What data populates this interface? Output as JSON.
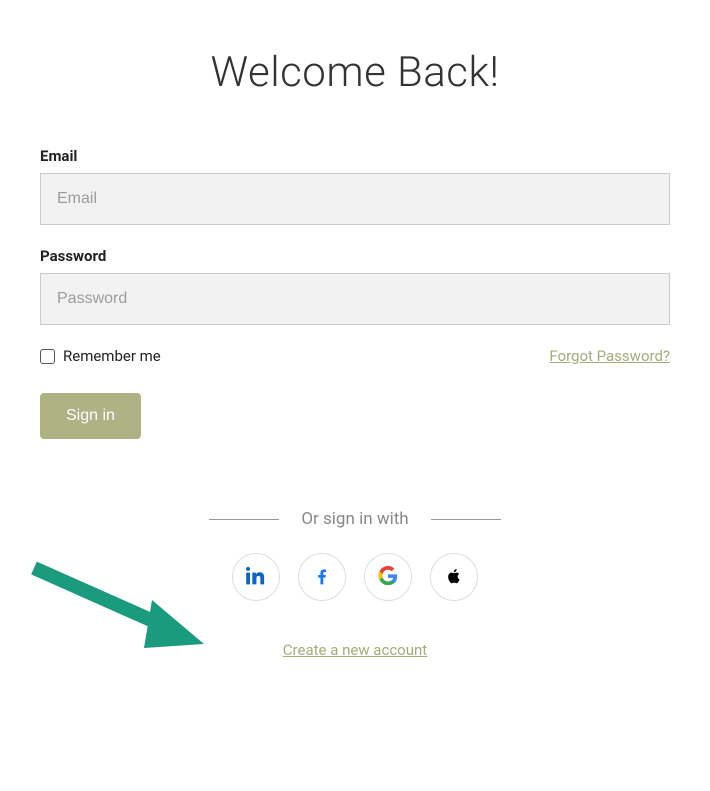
{
  "title": "Welcome Back!",
  "email": {
    "label": "Email",
    "placeholder": "Email",
    "value": ""
  },
  "password": {
    "label": "Password",
    "placeholder": "Password",
    "value": ""
  },
  "remember_label": "Remember me",
  "forgot_label": "Forgot Password?",
  "signin_label": "Sign in",
  "divider_label": "Or sign in with",
  "social": {
    "linkedin": "linkedin-icon",
    "facebook": "facebook-icon",
    "google": "google-icon",
    "apple": "apple-icon"
  },
  "create_account_label": "Create a new account",
  "colors": {
    "accent": "#aeb284",
    "link": "#a6ab7a",
    "annotation": "#1a9b7e"
  }
}
